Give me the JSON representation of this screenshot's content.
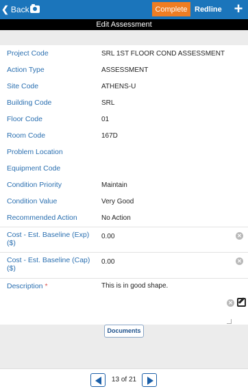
{
  "header": {
    "back_label": "Back",
    "complete_label": "Complete",
    "redline_label": "Redline",
    "add_label": "+",
    "icons": [
      "chevron-left-icon",
      "camera-icon",
      "plus-icon"
    ],
    "accent_color": "#ef7d22",
    "bar_color": "#1b75bb"
  },
  "title": "Edit Assessment",
  "fields": {
    "project_code": {
      "label": "Project Code",
      "value": "SRL 1ST FLOOR COND ASSESSMENT"
    },
    "action_type": {
      "label": "Action Type",
      "value": "ASSESSMENT"
    },
    "site_code": {
      "label": "Site Code",
      "value": "ATHENS-U"
    },
    "building_code": {
      "label": "Building Code",
      "value": "SRL"
    },
    "floor_code": {
      "label": "Floor Code",
      "value": "01"
    },
    "room_code": {
      "label": "Room Code",
      "value": "167D"
    },
    "problem_location": {
      "label": "Problem Location",
      "value": ""
    },
    "equipment_code": {
      "label": "Equipment Code",
      "value": ""
    },
    "condition_priority": {
      "label": "Condition Priority",
      "value": "Maintain"
    },
    "condition_value": {
      "label": "Condition Value",
      "value": "Very Good"
    },
    "recommended_action": {
      "label": "Recommended Action",
      "value": "No Action"
    },
    "cost_exp": {
      "label": "Cost - Est. Baseline (Exp) ($)",
      "value": "0.00"
    },
    "cost_cap": {
      "label": "Cost - Est. Baseline (Cap) ($)",
      "value": "0.00"
    },
    "description": {
      "label": "Description",
      "required_mark": "*",
      "value": "This is in good shape."
    }
  },
  "documents_label": "Documents",
  "pager": {
    "text": "13 of 21"
  }
}
